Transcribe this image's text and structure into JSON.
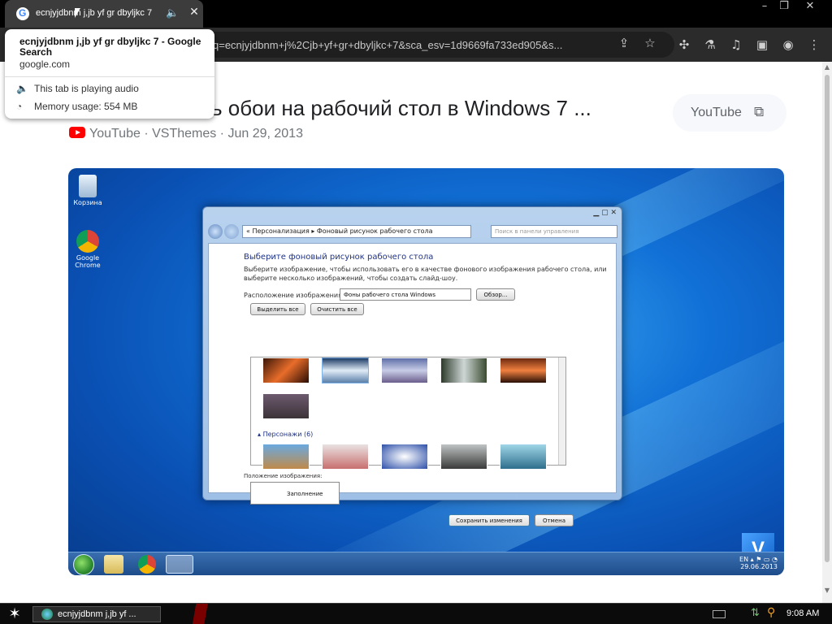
{
  "tab": {
    "title": "ecnjyjdbnm j,jb yf gr dbyljkc 7",
    "favicon": "google-g-icon",
    "audio_icon": "speaker-icon",
    "close_icon": "close-icon"
  },
  "window_controls": {
    "minimize": "–",
    "restore": "❐",
    "close": "✕"
  },
  "toolbar": {
    "url": "q=ecnjyjdbnm+j%2Cjb+yf+gr+dbyljkc+7&sca_esv=1d9669fa733ed905&s...",
    "icons": [
      "share-icon",
      "star-icon",
      "extensions-icon",
      "labs-icon",
      "media-icon",
      "sidepanel-icon",
      "profile-icon",
      "menu-icon"
    ]
  },
  "hover_card": {
    "title": "ecnjyjdbnm j,jb yf gr dbyljkc 7 - Google Search",
    "domain": "google.com",
    "audio_text": "This tab is playing audio",
    "memory_text": "Memory usage: 554 MB"
  },
  "result": {
    "title": "ь обои на рабочий стол в Windows 7 ...",
    "source": "YouTube",
    "channel": "VSThemes",
    "date": "Jun 29, 2013",
    "meta_sep": " · ",
    "open_chip_label": "YouTube"
  },
  "video": {
    "desktop_icons": [
      {
        "label": "Корзина"
      },
      {
        "label": "Google Chrome"
      }
    ],
    "dialog": {
      "breadcrumb": "«  Персонализация  ▸  Фоновый рисунок рабочего стола",
      "search_placeholder": "Поиск в панели управления",
      "heading": "Выберите фоновый рисунок рабочего стола",
      "description_1": "Выберите изображение, чтобы использовать его в качестве фонового изображения рабочего стола, или",
      "description_2": "выберите несколько изображений, чтобы создать слайд-шоу.",
      "location_label": "Расположение изображения:",
      "location_value": "Фоны рабочего стола Windows",
      "browse_button": "Обзор...",
      "select_all_button": "Выделить все",
      "clear_all_button": "Очистить все",
      "group_label": "Персонажи (6)",
      "position_label": "Положение изображения:",
      "position_value": "Заполнение",
      "save_button": "Сохранить изменения",
      "cancel_button": "Отмена"
    },
    "tray": {
      "lang": "EN",
      "date": "29.06.2013"
    },
    "watermark": "V"
  },
  "os_taskbar": {
    "task_label": "ecnjyjdbnm j,jb yf ...",
    "clock": "9:08 AM"
  }
}
